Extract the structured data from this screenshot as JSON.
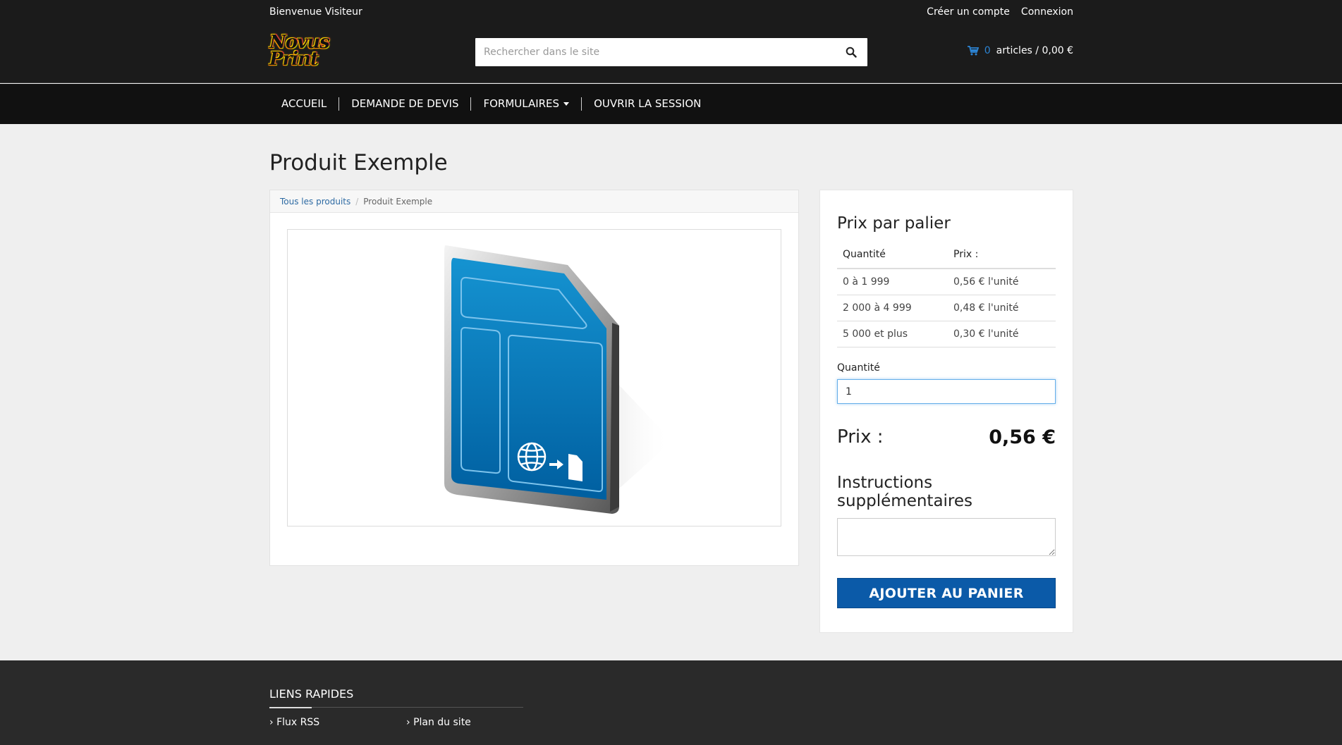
{
  "header": {
    "welcome": "Bienvenue Visiteur",
    "links": {
      "create_account": "Créer un compte",
      "login": "Connexion"
    },
    "logo_text": [
      "Novus",
      "Print"
    ],
    "search_placeholder": "Rechercher dans le site",
    "cart": {
      "count": "0",
      "text": "articles / 0,00 €"
    }
  },
  "nav": {
    "items": [
      "ACCUEIL",
      "DEMANDE DE DEVIS",
      "FORMULAIRES",
      "OUVRIR LA SESSION"
    ]
  },
  "page": {
    "title": "Produit Exemple",
    "breadcrumb": {
      "root": "Tous les produits",
      "current": "Produit Exemple"
    }
  },
  "pricing": {
    "title": "Prix par palier",
    "columns": [
      "Quantité",
      "Prix :"
    ],
    "rows": [
      [
        "0 à 1 999",
        "0,56 € l'unité"
      ],
      [
        "2 000 à 4 999",
        "0,48 € l'unité"
      ],
      [
        "5 000 et plus",
        "0,30 € l'unité"
      ]
    ],
    "quantity_label": "Quantité",
    "quantity_value": "1",
    "price_label": "Prix :",
    "price_value": "0,56 €",
    "instructions_label": "Instructions supplémentaires",
    "add_button": "AJOUTER AU PANIER"
  },
  "footer": {
    "title": "LIENS RAPIDES",
    "links": [
      "Flux RSS",
      "Plan du site"
    ]
  },
  "colors": {
    "accent": "#0b5aa8",
    "topbar": "#1b1b1b",
    "navbar": "#111111",
    "footer": "#2a2a2a",
    "cart_count": "#2c84d4"
  },
  "icons": [
    "search-icon",
    "cart-icon",
    "caret-down-icon",
    "chevron-right-icon",
    "globe-icon",
    "arrow-right-icon",
    "document-icon"
  ]
}
